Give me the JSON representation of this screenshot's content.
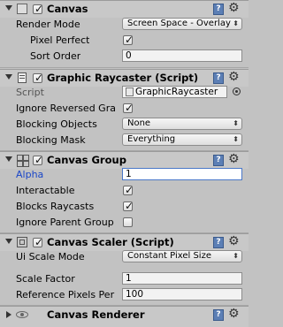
{
  "canvas": {
    "title": "Canvas",
    "enabled": true,
    "render_mode_label": "Render Mode",
    "render_mode_value": "Screen Space - Overlay",
    "pixel_perfect_label": "Pixel Perfect",
    "pixel_perfect_checked": true,
    "sort_order_label": "Sort Order",
    "sort_order_value": "0"
  },
  "graphic_raycaster": {
    "title": "Graphic Raycaster (Script)",
    "enabled": true,
    "script_label": "Script",
    "script_value": "GraphicRaycaster",
    "ignore_reversed_label": "Ignore Reversed Gra",
    "ignore_reversed_checked": true,
    "blocking_objects_label": "Blocking Objects",
    "blocking_objects_value": "None",
    "blocking_mask_label": "Blocking Mask",
    "blocking_mask_value": "Everything"
  },
  "canvas_group": {
    "title": "Canvas Group",
    "enabled": true,
    "alpha_label": "Alpha",
    "alpha_value": "1",
    "interactable_label": "Interactable",
    "interactable_checked": true,
    "blocks_raycasts_label": "Blocks Raycasts",
    "blocks_raycasts_checked": true,
    "ignore_parent_label": "Ignore Parent Group",
    "ignore_parent_checked": false
  },
  "canvas_scaler": {
    "title": "Canvas Scaler (Script)",
    "enabled": true,
    "ui_scale_mode_label": "Ui Scale Mode",
    "ui_scale_mode_value": "Constant Pixel Size",
    "scale_factor_label": "Scale Factor",
    "scale_factor_value": "1",
    "ref_pixels_label": "Reference Pixels Per",
    "ref_pixels_value": "100"
  },
  "canvas_renderer": {
    "title": "Canvas Renderer"
  },
  "icons": {
    "help": "?",
    "settings": "⚙",
    "dropdown": "⬍"
  },
  "colors": {
    "panel_bg": "#c2c2c2",
    "header_bg": "#c8c8c8",
    "focus_blue": "#1a46c8",
    "help_icon": "#5c7fb5"
  }
}
